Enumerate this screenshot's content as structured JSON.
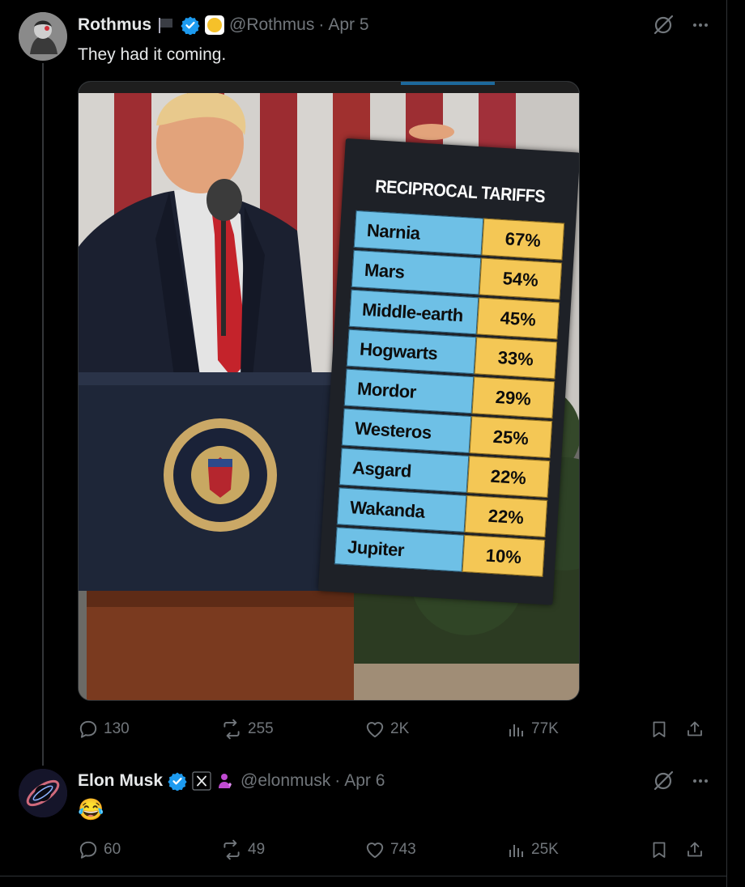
{
  "tweet1": {
    "name": "Rothmus",
    "handle": "@Rothmus",
    "separator": "·",
    "date": "Apr 5",
    "text": "They had it coming.",
    "badges": [
      "black-flag-icon",
      "verified-badge-icon",
      "yellow-circle-emoji"
    ],
    "stats": {
      "replies": "130",
      "reposts": "255",
      "likes": "2K",
      "views": "77K"
    },
    "image": {
      "board_title": "RECIPROCAL TARIFFS",
      "rows": [
        {
          "country": "Narnia",
          "rate": "67%"
        },
        {
          "country": "Mars",
          "rate": "54%"
        },
        {
          "country": "Middle-earth",
          "rate": "45%"
        },
        {
          "country": "Hogwarts",
          "rate": "33%"
        },
        {
          "country": "Mordor",
          "rate": "29%"
        },
        {
          "country": "Westeros",
          "rate": "25%"
        },
        {
          "country": "Asgard",
          "rate": "22%"
        },
        {
          "country": "Wakanda",
          "rate": "22%"
        },
        {
          "country": "Jupiter",
          "rate": "10%"
        }
      ],
      "seal_text": "SEAL OF THE PRESIDENT OF THE UNITED STATES"
    }
  },
  "tweet2": {
    "name": "Elon Musk",
    "handle": "@elonmusk",
    "separator": "·",
    "date": "Apr 6",
    "text": "😂",
    "badges": [
      "verified-badge-icon",
      "x-logo-badge",
      "person-emoji-icon"
    ],
    "stats": {
      "replies": "60",
      "reposts": "49",
      "likes": "743",
      "views": "25K"
    }
  },
  "colors": {
    "background": "#000000",
    "text_primary": "#e7e9ea",
    "text_secondary": "#71767b",
    "verified_blue": "#1d9bf0",
    "border": "#2f3336"
  }
}
